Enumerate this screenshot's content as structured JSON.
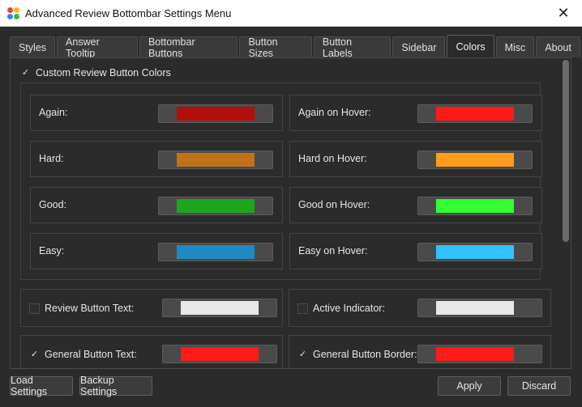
{
  "window": {
    "title": "Advanced Review Bottombar Settings Menu",
    "icon": "colorful-dots-app-icon",
    "close_glyph": "✕"
  },
  "tabs": [
    {
      "label": "Styles",
      "active": false
    },
    {
      "label": "Answer Tooltip",
      "active": false
    },
    {
      "label": "Bottombar Buttons",
      "active": false
    },
    {
      "label": "Button Sizes",
      "active": false
    },
    {
      "label": "Button Labels",
      "active": false
    },
    {
      "label": "Sidebar",
      "active": false
    },
    {
      "label": "Colors",
      "active": true
    },
    {
      "label": "Misc",
      "active": false
    },
    {
      "label": "About",
      "active": false
    }
  ],
  "colors": {
    "custom_toggle": {
      "label": "Custom Review Button Colors",
      "checked": true
    },
    "buttons": [
      {
        "label": "Again:",
        "color": "#b30e0e"
      },
      {
        "label": "Again on Hover:",
        "color": "#ff1a1a"
      },
      {
        "label": "Hard:",
        "color": "#c07218"
      },
      {
        "label": "Hard on Hover:",
        "color": "#ff9c1a"
      },
      {
        "label": "Good:",
        "color": "#1ea51e"
      },
      {
        "label": "Good on Hover:",
        "color": "#33ff33"
      },
      {
        "label": "Easy:",
        "color": "#1f8ac0"
      },
      {
        "label": "Easy on Hover:",
        "color": "#33c1ff"
      }
    ],
    "extras": [
      {
        "label": "Review Button Text:",
        "checked": false,
        "color": "#e8e8e8"
      },
      {
        "label": "Active Indicator:",
        "checked": false,
        "color": "#e8e8e8"
      },
      {
        "label": "General Button Text:",
        "checked": true,
        "color": "#ff1a1a"
      },
      {
        "label": "General Button Border:",
        "checked": true,
        "color": "#ff1a1a"
      }
    ]
  },
  "footer": {
    "load": "Load Settings",
    "backup": "Backup Settings",
    "apply": "Apply",
    "discard": "Discard"
  }
}
